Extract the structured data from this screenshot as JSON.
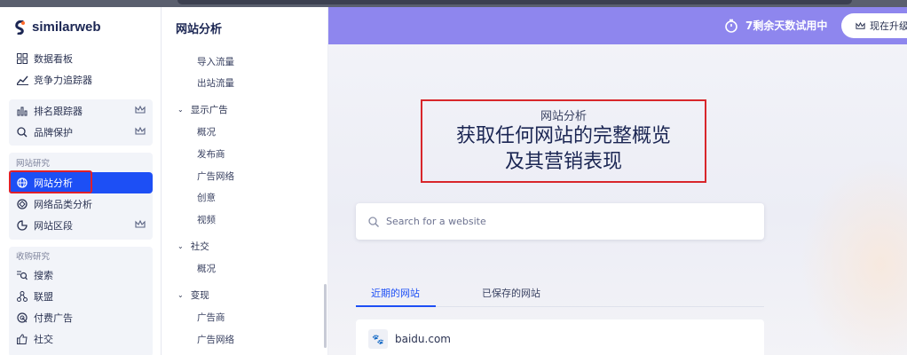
{
  "app": {
    "logo_text": "similarweb"
  },
  "sidebar": {
    "items_top": [
      {
        "label": "数据看板",
        "icon": "dashboard-icon"
      },
      {
        "label": "竞争力追踪器",
        "icon": "trend-line-icon"
      }
    ],
    "items_premium": [
      {
        "label": "排名跟踪器",
        "icon": "bar-chart-icon"
      },
      {
        "label": "品牌保护",
        "icon": "brand-search-icon"
      }
    ],
    "group_website_research": "网站研究",
    "items_website": [
      {
        "label": "网站分析",
        "icon": "globe-icon",
        "active": true
      },
      {
        "label": "网络品类分析",
        "icon": "category-icon"
      },
      {
        "label": "网站区段",
        "icon": "segment-icon"
      }
    ],
    "group_acquisition": "收购研究",
    "items_acquisition": [
      {
        "label": "搜索",
        "icon": "keyword-search-icon"
      },
      {
        "label": "联盟",
        "icon": "affiliate-icon"
      },
      {
        "label": "付费广告",
        "icon": "ads-target-icon"
      },
      {
        "label": "社交",
        "icon": "thumbs-up-icon"
      }
    ]
  },
  "subnav": {
    "title": "网站分析",
    "items": [
      {
        "type": "item",
        "label": "导入流量"
      },
      {
        "type": "item",
        "label": "出站流量"
      },
      {
        "type": "head",
        "label": "显示广告"
      },
      {
        "type": "item",
        "label": "概况"
      },
      {
        "type": "item",
        "label": "发布商"
      },
      {
        "type": "item",
        "label": "广告网络"
      },
      {
        "type": "item",
        "label": "创意"
      },
      {
        "type": "item",
        "label": "视频"
      },
      {
        "type": "head",
        "label": "社交"
      },
      {
        "type": "item",
        "label": "概况"
      },
      {
        "type": "head",
        "label": "变现"
      },
      {
        "type": "item",
        "label": "广告商"
      },
      {
        "type": "item",
        "label": "广告网络"
      }
    ]
  },
  "header": {
    "trial_text": "7剩余天数试用中",
    "upgrade_label": "现在升级"
  },
  "hero": {
    "subtitle": "网站分析",
    "title_line1": "获取任何网站的完整概览",
    "title_line2": "及其营销表现"
  },
  "search": {
    "placeholder": "Search for a website"
  },
  "tabs": [
    {
      "label": "近期的网站",
      "active": true
    },
    {
      "label": "已保存的网站",
      "active": false
    }
  ],
  "recent_sites": [
    {
      "name": "baidu.com",
      "favicon": "🐾"
    }
  ],
  "colors": {
    "accent": "#1d4ff5",
    "trial_bar": "#8e86ee",
    "highlight_box": "#e0202a"
  }
}
